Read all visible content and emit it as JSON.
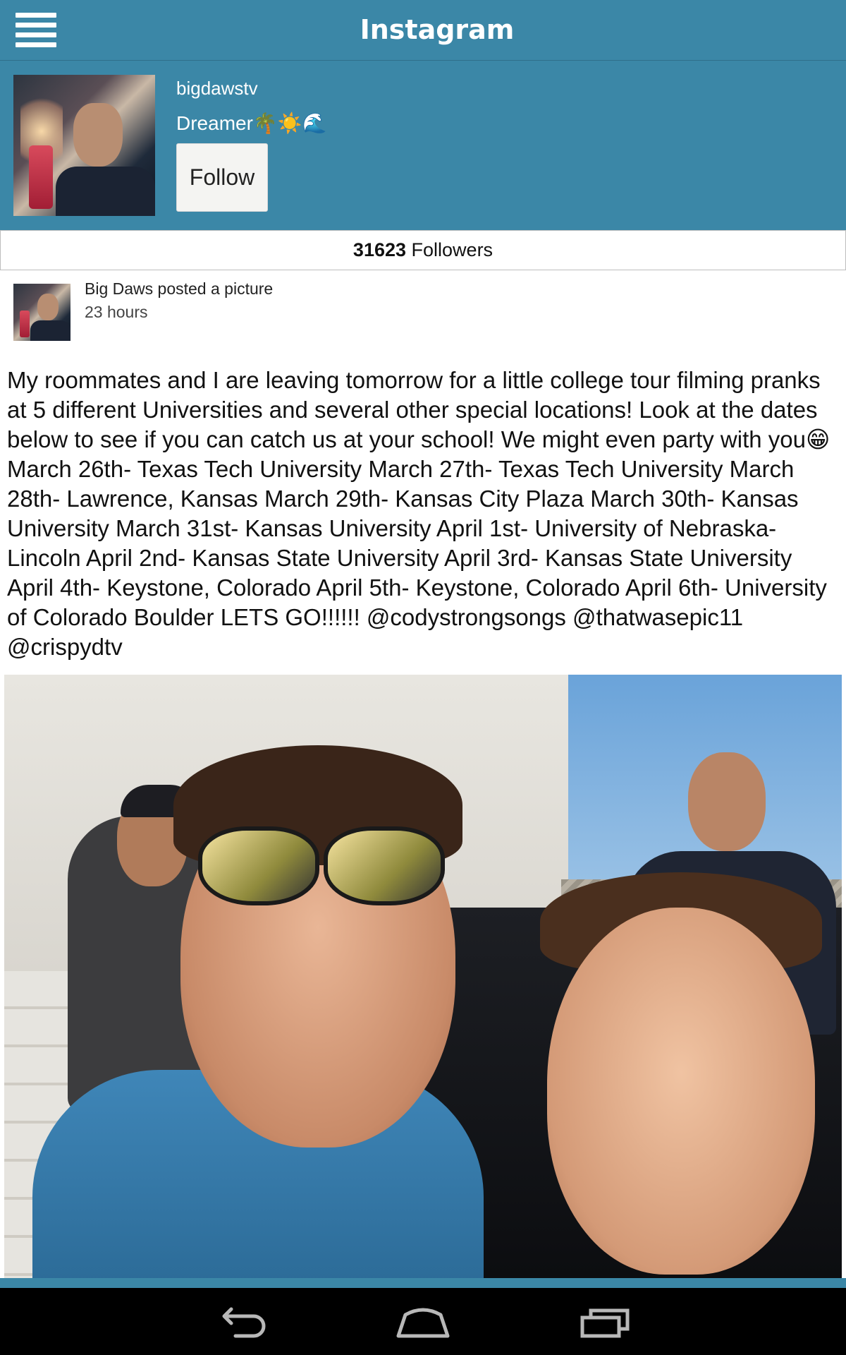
{
  "app_bar": {
    "title": "Instagram",
    "menu_icon": "hamburger-menu-icon"
  },
  "profile": {
    "username": "bigdawstv",
    "bio": "Dreamer🌴☀️🌊",
    "follow_label": "Follow",
    "followers_count": "31623",
    "followers_label": "Followers"
  },
  "post": {
    "author_line": "Big Daws posted a picture",
    "time": "23 hours",
    "caption": "My roommates and I are leaving tomorrow for a little college tour filming pranks at 5 different Universities and several other special locations! Look at the dates below to see if you can catch us at your school! We might even party with you😁 March 26th- Texas Tech University March 27th- Texas Tech University March 28th- Lawrence, Kansas March 29th- Kansas City Plaza March 30th- Kansas University March 31st- Kansas University April 1st- University of Nebraska-Lincoln April 2nd- Kansas State University April 3rd- Kansas State University April 4th- Keystone, Colorado April 5th- Keystone, Colorado April 6th- University of Colorado Boulder LETS GO!!!!!! @codystrongsongs @thatwasepic11 @crispydtv"
  },
  "colors": {
    "accent": "#3b87a7",
    "navbar": "#000000"
  },
  "system_nav": {
    "back_icon": "back-icon",
    "home_icon": "home-icon",
    "recents_icon": "recents-icon"
  }
}
